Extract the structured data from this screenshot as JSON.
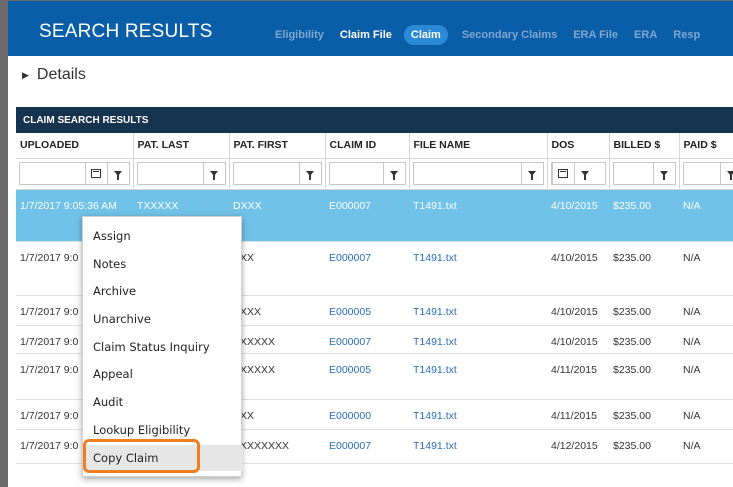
{
  "header": {
    "title": "SEARCH RESULTS",
    "tabs": [
      {
        "label": "Eligibility",
        "state": "dim"
      },
      {
        "label": "Claim File",
        "state": "light"
      },
      {
        "label": "Claim",
        "state": "active"
      },
      {
        "label": "Secondary Claims",
        "state": "dim"
      },
      {
        "label": "ERA File",
        "state": "dim"
      },
      {
        "label": "ERA",
        "state": "dim"
      },
      {
        "label": "Resp",
        "state": "dim"
      }
    ]
  },
  "details": {
    "label": "Details"
  },
  "results": {
    "title": "CLAIM SEARCH RESULTS"
  },
  "table": {
    "columns": [
      "UPLOADED",
      "PAT. LAST",
      "PAT. FIRST",
      "CLAIM ID",
      "FILE NAME",
      "DOS",
      "BILLED $",
      "PAID $"
    ],
    "rows": [
      {
        "uploaded": "1/7/2017 9:05:36 AM",
        "last": "TXXXXX",
        "first": "DXXX",
        "claim_id": "E000007",
        "file": "T1491.txt",
        "dos": "4/10/2015",
        "billed": "$235.00",
        "paid": "N/A",
        "selected": true
      },
      {
        "uploaded": "1/7/2017 9:0",
        "last": "",
        "first": "XXX",
        "claim_id": "E000007",
        "file": "T1491.txt",
        "dos": "4/10/2015",
        "billed": "$235.00",
        "paid": "N/A",
        "selected": false
      },
      {
        "uploaded": "1/7/2017 9:0",
        "last": "",
        "first": "XXXX",
        "claim_id": "E000005",
        "file": "T1491.txt",
        "dos": "4/10/2015",
        "billed": "$235.00",
        "paid": "N/A",
        "selected": false
      },
      {
        "uploaded": "1/7/2017 9:0",
        "last": "",
        "first": "XXXXXX",
        "claim_id": "E000007",
        "file": "T1491.txt",
        "dos": "4/10/2015",
        "billed": "$235.00",
        "paid": "N/A",
        "selected": false
      },
      {
        "uploaded": "1/7/2017 9:0",
        "last": "",
        "first": "XXXXXX",
        "claim_id": "E000005",
        "file": "T1491.txt",
        "dos": "4/11/2015",
        "billed": "$235.00",
        "paid": "N/A",
        "selected": false
      },
      {
        "uploaded": "1/7/2017 9:0",
        "last": "",
        "first": "XXX",
        "claim_id": "E000000",
        "file": "T1491.txt",
        "dos": "4/11/2015",
        "billed": "$235.00",
        "paid": "N/A",
        "selected": false
      },
      {
        "uploaded": "1/7/2017 9:0",
        "last": "",
        "first": "XXXXXXXX",
        "claim_id": "E000007",
        "file": "T1491.txt",
        "dos": "4/12/2015",
        "billed": "$235.00",
        "paid": "N/A",
        "selected": false
      }
    ]
  },
  "context_menu": {
    "items": [
      "Assign",
      "Notes",
      "Archive",
      "Unarchive",
      "Claim Status Inquiry",
      "Appeal",
      "Audit",
      "Lookup Eligibility",
      "Copy Claim"
    ],
    "highlighted": "Copy Claim"
  },
  "colors": {
    "header_bg": "#0a5ea8",
    "results_bar": "#16344f",
    "selected_row": "#71c2e8",
    "link": "#2a6ebb",
    "callout": "#ef7d22"
  }
}
